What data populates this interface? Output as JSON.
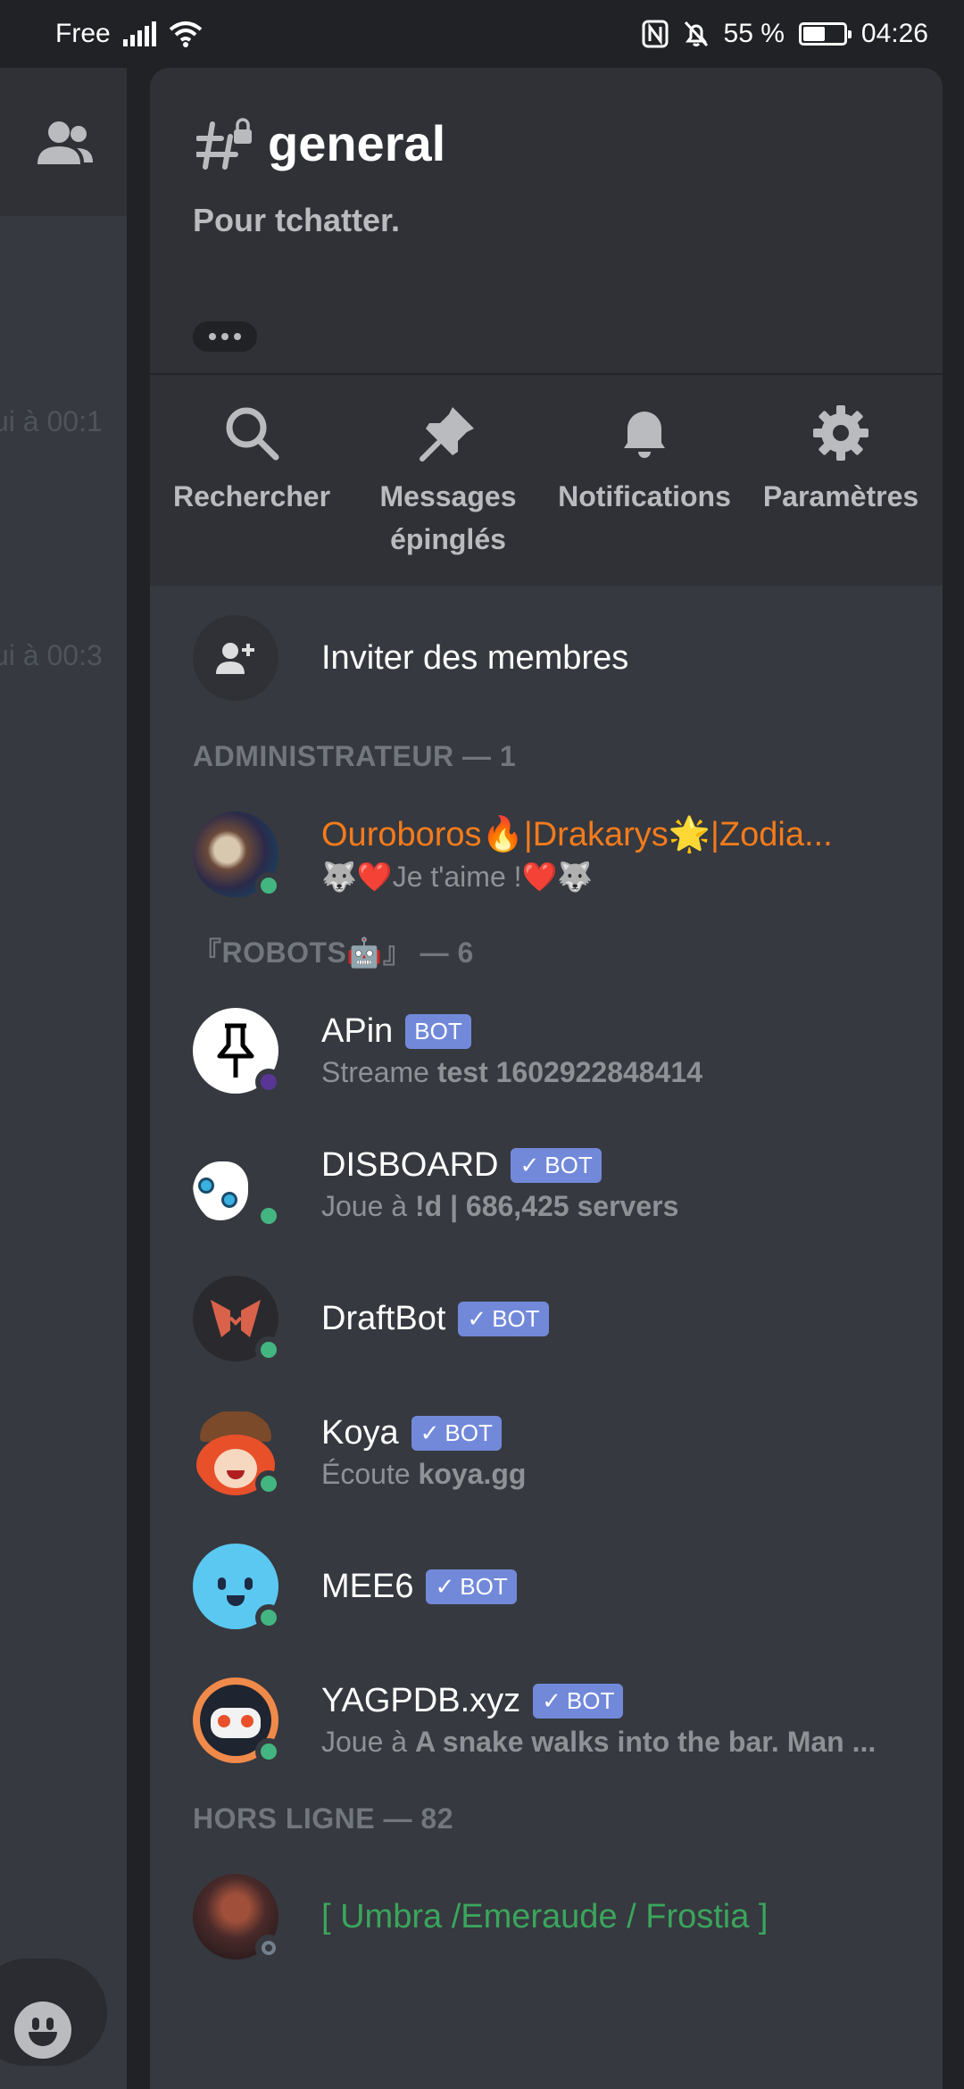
{
  "status_bar": {
    "carrier": "Free",
    "battery_percent": "55 %",
    "battery_level": 0.55,
    "time": "04:26"
  },
  "behind": {
    "timestamps": [
      "ui à 00:1",
      "ui à 00:3"
    ]
  },
  "channel": {
    "name": "general",
    "topic": "Pour tchatter."
  },
  "actions": [
    {
      "label": "Rechercher",
      "icon": "search-icon"
    },
    {
      "label": "Messages épinglés",
      "icon": "pin-icon"
    },
    {
      "label": "Notifications",
      "icon": "bell-icon"
    },
    {
      "label": "Paramètres",
      "icon": "gear-icon"
    }
  ],
  "invite": {
    "label": "Inviter des membres"
  },
  "sections": {
    "admin": "ADMINISTRATEUR — 1",
    "robots": "『ROBOTS🤖』 — 6",
    "offline": "HORS LIGNE — 82"
  },
  "bot_label": "BOT",
  "members": {
    "admin": {
      "name": "Ouroboros🔥|Drakarys🌟|Zodia...",
      "status": "🐺❤️Je t'aime !❤️🐺",
      "name_color": "#f47b1c"
    },
    "apin": {
      "name": "APin",
      "status_prefix": "Streame ",
      "status_value": "test 1602922848414"
    },
    "disboard": {
      "name": "DISBOARD",
      "status_prefix": "Joue à ",
      "status_value": "!d | 686,425 servers"
    },
    "draftbot": {
      "name": "DraftBot"
    },
    "koya": {
      "name": "Koya",
      "status_prefix": "Écoute ",
      "status_value": "koya.gg"
    },
    "mee6": {
      "name": "MEE6"
    },
    "yagpdb": {
      "name": "YAGPDB.xyz",
      "status_prefix": "Joue à ",
      "status_value": "A snake walks into the bar. Man ..."
    },
    "offline1": {
      "name": "[ Umbra /Emeraude / Frostia ]",
      "name_color": "#3ba55d"
    }
  },
  "colors": {
    "bot_tag": "#7289da",
    "online": "#43b581",
    "streaming": "#593695"
  }
}
